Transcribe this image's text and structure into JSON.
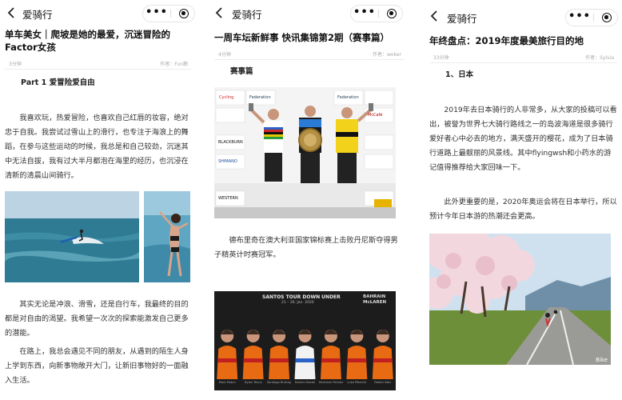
{
  "panels": [
    {
      "nav_title": "爱骑行",
      "more_label": "•••",
      "title": "单车美女｜爬坡是她的最爱，沉迷冒险的Factor女孩",
      "meta_left": "3分钟",
      "meta_right": "作者：Fun鹅",
      "section": "Part 1 爱冒险爱自由",
      "paragraphs": [
        "我喜欢玩，热爱冒险，也喜欢自己红唇的妆容，绝对忠于自我。我尝试过雪山上的滑行，也专注于海浪上的舞蹈，在参与这些运动的时候，我总是和自己较劲，沉迷其中无法自拔，我有过大半月都泡在海里的经历，也沉浸在清新的清晨山间骑行。",
        "其实无论是冲浪、滑雪，还是自行车，我最终的目的都是对自由的渴望。我希望一次次的探索能激发自己更多的潜能。",
        "在路上，我总会遇见不同的朋友，从遇到的陌生人身上学到东西，向新事物敞开大门，让新旧事物好的一面融入生活。"
      ]
    },
    {
      "nav_title": "爱骑行",
      "more_label": "•••",
      "title": "一周车坛新鲜事 快讯集锦第2期（赛事篇）",
      "meta_left": "4分钟",
      "meta_right": "作者：woker",
      "section": "赛事篇",
      "paragraphs": [
        "德布里奇在澳大利亚国家锦标赛上击败丹尼斯夺得男子精英计时赛冠军。"
      ],
      "poster": {
        "title": "SANTOS TOUR DOWN UNDER",
        "sub": "21 – 26. Jan. 2020",
        "brand_top": "BAHRAIN",
        "brand_bottom": "McLAREN",
        "riders": [
          "Mark Padun",
          "Dylan Teuns",
          "Santiago Buitrago",
          "Domen Novak",
          "Hermann Pernsteiner",
          "Luka Pibernik",
          "Rafael Valls"
        ]
      },
      "podium": {
        "sponsors": [
          "Federation",
          "Cycling",
          "Federation",
          "McCafé",
          "BLACKBURN",
          "SHIMANO",
          "WESTERN"
        ]
      }
    },
    {
      "nav_title": "爱骑行",
      "more_label": "•••",
      "title": "年终盘点：2019年度最美旅行目的地",
      "meta_left": "33分钟",
      "meta_right": "作者：Sylvia",
      "section": "1、日本",
      "paragraphs": [
        "2019年去日本骑行的人非常多，从大家的投稿可以看出，被誉为世界七大骑行路线之一的岛波海道是很多骑行爱好者心中必去的地方，满天盛开的樱花，成为了日本骑行道路上最靓丽的风景线。其中flyingwsh和小药水的游记值得推荐给大家回味一下。",
        "此外更重要的是，2020年奥运会将在日本举行，所以预计今年日本游的热潮还会更高。"
      ],
      "photo_watermark": "Bike"
    }
  ]
}
